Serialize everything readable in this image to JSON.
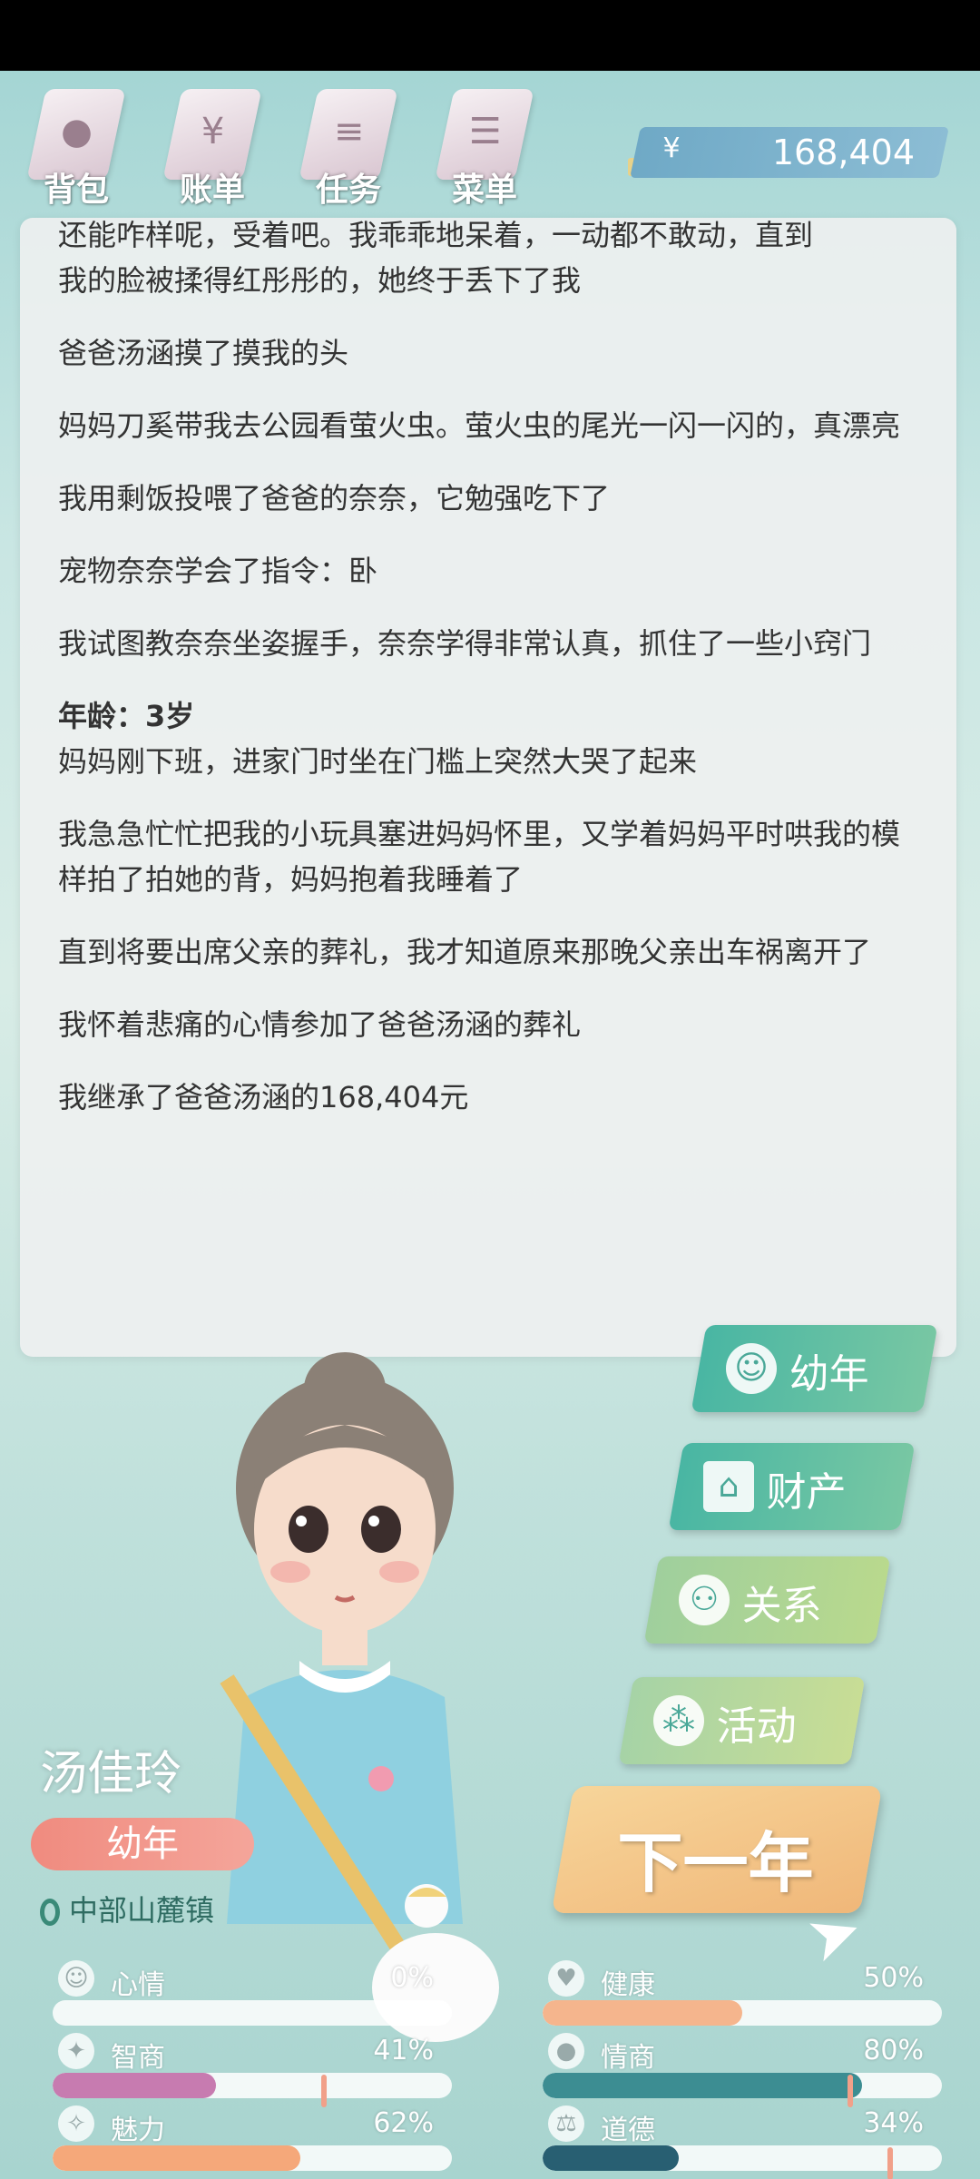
{
  "menu": [
    {
      "label": "背包",
      "icon": "bag-icon"
    },
    {
      "label": "账单",
      "icon": "bill-icon"
    },
    {
      "label": "任务",
      "icon": "task-icon"
    },
    {
      "label": "菜单",
      "icon": "menu-icon"
    }
  ],
  "money": {
    "symbol": "¥",
    "value": "168,404"
  },
  "story": {
    "cut_line": "还能咋样呢，受着吧。我乖乖地呆着，一动都不敢动，直到",
    "lines_before": [
      "我的脸被揉得红彤彤的，她终于丢下了我",
      "爸爸汤涵摸了摸我的头",
      "妈妈刀奚带我去公园看萤火虫。萤火虫的尾光一闪一闪的，真漂亮",
      "我用剩饭投喂了爸爸的奈奈，它勉强吃下了",
      "宠物奈奈学会了指令：卧",
      "我试图教奈奈坐姿握手，奈奈学得非常认真，抓住了一些小窍门"
    ],
    "age_heading": "年龄：3岁",
    "lines_after": [
      "妈妈刚下班，进家门时坐在门槛上突然大哭了起来",
      "我急急忙忙把我的小玩具塞进妈妈怀里，又学着妈妈平时哄我的模样拍了拍她的背，妈妈抱着我睡着了",
      "直到将要出席父亲的葬礼，我才知道原来那晚父亲出车祸离开了",
      "我怀着悲痛的心情参加了爸爸汤涵的葬礼",
      "我继承了爸爸汤涵的168,404元"
    ]
  },
  "side_buttons": [
    {
      "label": "幼年",
      "icon": "baby-icon"
    },
    {
      "label": "财产",
      "icon": "house-icon"
    },
    {
      "label": "关系",
      "icon": "people-icon"
    },
    {
      "label": "活动",
      "icon": "activity-icon"
    }
  ],
  "next_button": "下一年",
  "character": {
    "name": "汤佳玲",
    "stage": "幼年",
    "location": "中部山麓镇"
  },
  "stats": [
    {
      "label": "心情",
      "pct": "0%",
      "value": 0,
      "color": "#f0a58d",
      "icon": "smile-icon"
    },
    {
      "label": "健康",
      "pct": "50%",
      "value": 50,
      "color": "#f5b58d",
      "icon": "heart-icon"
    },
    {
      "label": "智商",
      "pct": "41%",
      "value": 41,
      "color": "#c77bb0",
      "icon": "bulb-icon"
    },
    {
      "label": "情商",
      "pct": "80%",
      "value": 80,
      "color": "#3c8d92",
      "icon": "apple-icon"
    },
    {
      "label": "魅力",
      "pct": "62%",
      "value": 62,
      "color": "#f5a87a",
      "icon": "sparkle-icon"
    },
    {
      "label": "道德",
      "pct": "34%",
      "value": 34,
      "color": "#285f72",
      "icon": "scale-icon"
    }
  ]
}
